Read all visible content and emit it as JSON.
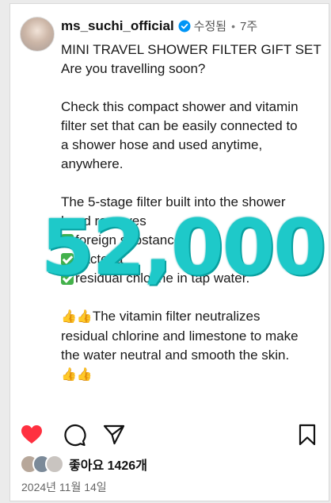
{
  "post": {
    "username": "ms_suchi_official",
    "edited_label": "수정됨",
    "separator": "•",
    "time_ago": "7주",
    "caption_lines": {
      "l1": "MINI TRAVEL SHOWER FILTER GIFT SET",
      "l2": "Are you travelling soon?",
      "l3": "Check this compact shower and vitamin",
      "l4": "filter set that can be easily connected to",
      "l5": "a shower hose and used anytime,",
      "l6": "anywhere.",
      "l7": "The 5-stage filter built into the shower",
      "l8": "head removes",
      "l9": "foreign substances",
      "l10": "bacteria",
      "l11": "residual chlorine in tap water.",
      "l12": "The vitamin filter neutralizes",
      "l13": "residual chlorine and limestone to make",
      "l14": "the water neutral and smooth the skin."
    },
    "overlay_number": "52,000",
    "likes_text": "좋아요 1426개",
    "date": "2024년 11월 14일"
  },
  "icons": {
    "like": "heart-icon",
    "comment": "comment-icon",
    "share": "send-icon",
    "save": "bookmark-icon",
    "verified": "verified-badge-icon"
  },
  "colors": {
    "like_red": "#ff3040",
    "verified_blue": "#0095f6",
    "overlay_teal": "#1ec9c9"
  }
}
